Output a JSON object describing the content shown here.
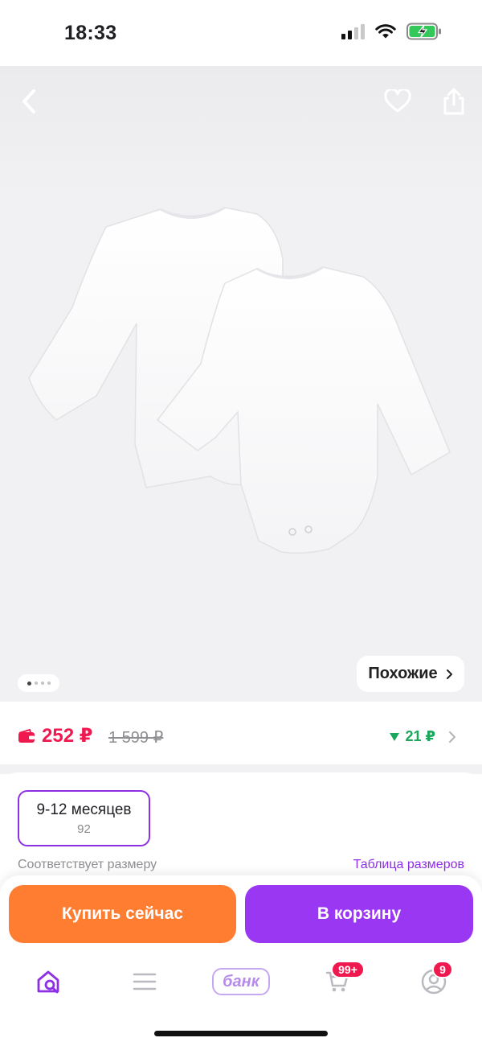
{
  "status_bar": {
    "time": "18:33",
    "icons": [
      "signal-icon",
      "wifi-icon",
      "battery-charging-icon"
    ]
  },
  "header": {
    "icons": [
      "back-chevron-icon",
      "heart-icon",
      "share-icon"
    ]
  },
  "gallery": {
    "image_icon": "baby-bodysuits-image",
    "pages": 4,
    "current_page": 1,
    "similar_label": "Похожие"
  },
  "price": {
    "current": "252 ₽",
    "old": "1 599 ₽",
    "cashback": "21 ₽",
    "accent_color": "#f0194f",
    "cashback_color": "#19a75b"
  },
  "size": {
    "selected_label": "9-12 месяцев",
    "selected_sub": "92",
    "note": "Соответствует размеру",
    "table_link": "Таблица размеров"
  },
  "actions": {
    "buy_now": "Купить сейчас",
    "add_to_cart": "В корзину",
    "buy_color": "#ff7d31",
    "cart_color": "#9a37f2"
  },
  "tabbar": {
    "bank_label": "банк",
    "cart_badge": "99+",
    "profile_badge": "9",
    "items": [
      "home-search-icon",
      "catalog-menu-icon",
      "bank-icon",
      "cart-icon",
      "profile-icon"
    ]
  }
}
